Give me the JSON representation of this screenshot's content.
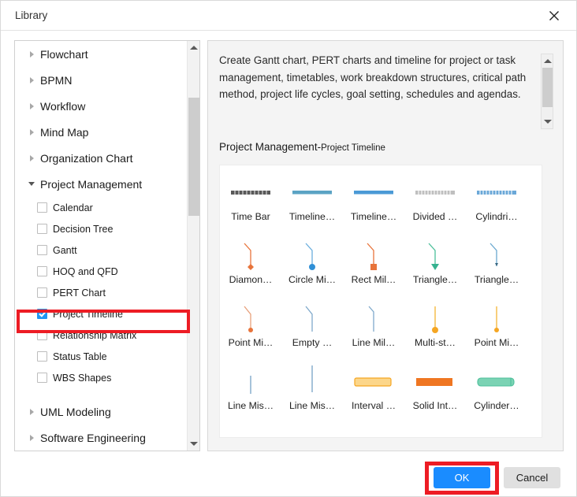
{
  "window": {
    "title": "Library",
    "close_icon": "close-icon"
  },
  "tree": {
    "groups": [
      {
        "label": "Flowchart",
        "expanded": false
      },
      {
        "label": "BPMN",
        "expanded": false
      },
      {
        "label": "Workflow",
        "expanded": false
      },
      {
        "label": "Mind Map",
        "expanded": false
      },
      {
        "label": "Organization Chart",
        "expanded": false
      },
      {
        "label": "Project Management",
        "expanded": true
      },
      {
        "label": "UML Modeling",
        "expanded": false
      },
      {
        "label": "Software Engineering",
        "expanded": false
      }
    ],
    "project_management_items": [
      {
        "label": "Calendar",
        "checked": false
      },
      {
        "label": "Decision Tree",
        "checked": false
      },
      {
        "label": "Gantt",
        "checked": false
      },
      {
        "label": "HOQ and QFD",
        "checked": false
      },
      {
        "label": "PERT Chart",
        "checked": false
      },
      {
        "label": "Project Timeline",
        "checked": true
      },
      {
        "label": "Relationship Matrix",
        "checked": false
      },
      {
        "label": "Status Table",
        "checked": false
      },
      {
        "label": "WBS Shapes",
        "checked": false
      }
    ],
    "scrollbar": {
      "up_icon": "chevron-up-icon",
      "down_icon": "chevron-down-icon"
    }
  },
  "details": {
    "description": "Create Gantt chart, PERT charts and timeline for project or task management, timetables, work breakdown structures, critical path method, project life cycles, goal setting, schedules and agendas.",
    "scrollbar": {
      "up_icon": "chevron-up-icon",
      "down_icon": "chevron-down-icon"
    },
    "breadcrumb_main": "Project Management",
    "breadcrumb_separator": "-",
    "breadcrumb_sub": "Project Timeline"
  },
  "gallery": {
    "rows": [
      [
        {
          "label": "Time Bar",
          "icon": "time-bar-shape"
        },
        {
          "label": "Timeline…",
          "icon": "timeline-bar-teal-shape"
        },
        {
          "label": "Timeline…",
          "icon": "timeline-bar-blue-shape"
        },
        {
          "label": "Divided …",
          "icon": "divided-bar-gray-shape"
        },
        {
          "label": "Cylindri…",
          "icon": "cylindrical-divided-bar-shape"
        }
      ],
      [
        {
          "label": "Diamon…",
          "icon": "diamond-milestone-shape"
        },
        {
          "label": "Circle Mi…",
          "icon": "circle-milestone-shape"
        },
        {
          "label": "Rect Mil…",
          "icon": "rect-milestone-shape"
        },
        {
          "label": "Triangle…",
          "icon": "triangle-milestone-green-shape"
        },
        {
          "label": "Triangle…",
          "icon": "triangle-milestone-blue-shape"
        }
      ],
      [
        {
          "label": "Point Mi…",
          "icon": "point-milestone-orange-shape"
        },
        {
          "label": "Empty …",
          "icon": "empty-milestone-shape"
        },
        {
          "label": "Line Mil…",
          "icon": "line-milestone-shape"
        },
        {
          "label": "Multi-st…",
          "icon": "multi-stage-milestone-shape"
        },
        {
          "label": "Point Mi…",
          "icon": "point-milestone-yellow-shape"
        }
      ],
      [
        {
          "label": "Line Mis…",
          "icon": "line-mistone-short-shape"
        },
        {
          "label": "Line Mis…",
          "icon": "line-mistone-tall-shape"
        },
        {
          "label": "Interval …",
          "icon": "interval-bar-yellow-shape"
        },
        {
          "label": "Solid Int…",
          "icon": "solid-interval-orange-shape"
        },
        {
          "label": "Cylinder…",
          "icon": "cylinder-interval-green-shape"
        }
      ]
    ]
  },
  "footer": {
    "ok_label": "OK",
    "cancel_label": "Cancel"
  },
  "colors": {
    "accent_blue": "#1a8cff",
    "highlight_red": "#ed1c24",
    "checkbox_blue": "#2196f3",
    "shape_orange": "#e8743b",
    "shape_blue": "#3f8fd4",
    "shape_green": "#4cbf9a",
    "shape_yellow": "#f5a623",
    "shape_gray": "#5a5a5a"
  }
}
